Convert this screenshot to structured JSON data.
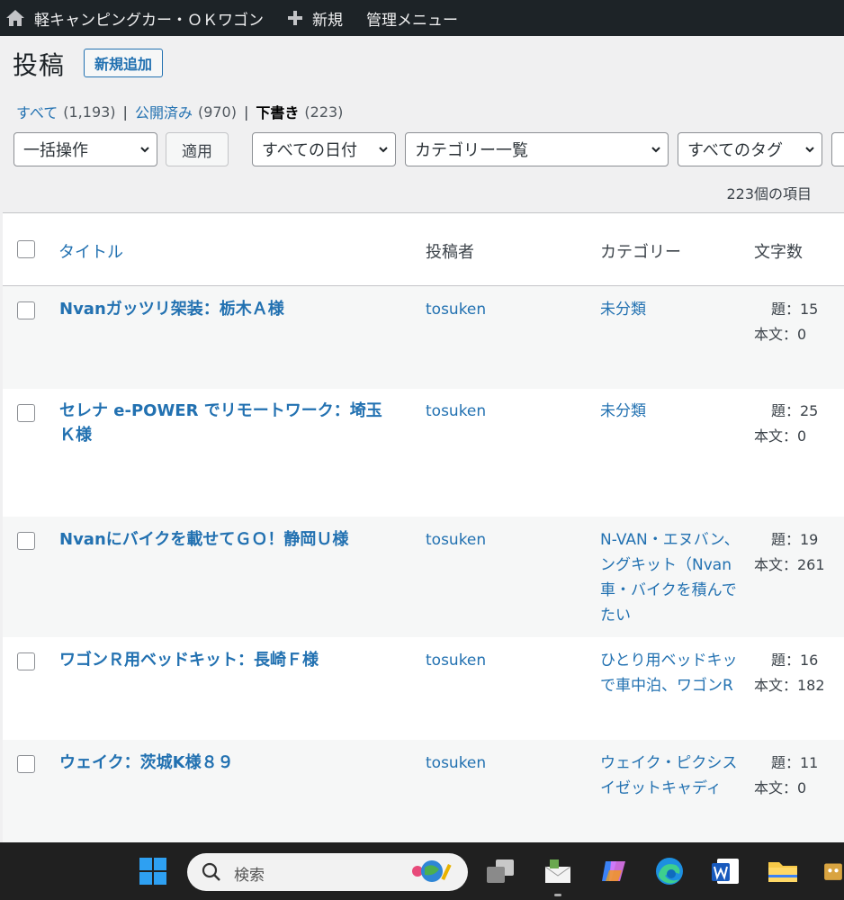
{
  "adminbar": {
    "site_name": "軽キャンピングカー・ＯＫワゴン",
    "new_label": "新規",
    "menu_label": "管理メニュー"
  },
  "header": {
    "title": "投稿",
    "add_new_label": "新規追加"
  },
  "views": {
    "all": {
      "label": "すべて",
      "count": "(1,193)"
    },
    "publish": {
      "label": "公開済み",
      "count": "(970)"
    },
    "draft": {
      "label": "下書き",
      "count": "(223)"
    }
  },
  "filters": {
    "bulk_action": "一括操作",
    "apply": "適用",
    "dates": "すべての日付",
    "categories": "カテゴリー一覧",
    "tags": "すべてのタグ"
  },
  "items_count": "223個の項目",
  "table": {
    "columns": {
      "title": "タイトル",
      "author": "投稿者",
      "categories": "カテゴリー",
      "word_count": "文字数"
    },
    "rows": [
      {
        "title": "Nvanガッツリ架装：栃木Ａ様",
        "author": "tosuken",
        "categories": [
          "未分類"
        ],
        "wc_title": "題：15",
        "wc_body": "本文：0"
      },
      {
        "title": "セレナ e-POWER でリモートワーク：埼玉Ｋ様",
        "author": "tosuken",
        "categories": [
          "未分類"
        ],
        "wc_title": "題：25",
        "wc_body": "本文：0"
      },
      {
        "title": "Nvanにバイクを載せてＧＯ！静岡Ｕ様",
        "author": "tosuken",
        "categories": [
          "N-VAN・エヌバン、",
          "ングキット（Nvan",
          "車・バイクを積んで",
          "たい"
        ],
        "wc_title": "題：19",
        "wc_body": "本文：261"
      },
      {
        "title": "ワゴンＲ用ベッドキット：長崎Ｆ様",
        "author": "tosuken",
        "categories": [
          "ひとり用ベッドキッ",
          "で車中泊、ワゴンR"
        ],
        "wc_title": "題：16",
        "wc_body": "本文：182"
      },
      {
        "title": "ウェイク：茨城K様８９",
        "author": "tosuken",
        "categories": [
          "ウェイク・ピクシス",
          "イゼットキャディ"
        ],
        "wc_title": "題：11",
        "wc_body": "本文：0"
      }
    ]
  },
  "taskbar": {
    "search_placeholder": "検索"
  }
}
